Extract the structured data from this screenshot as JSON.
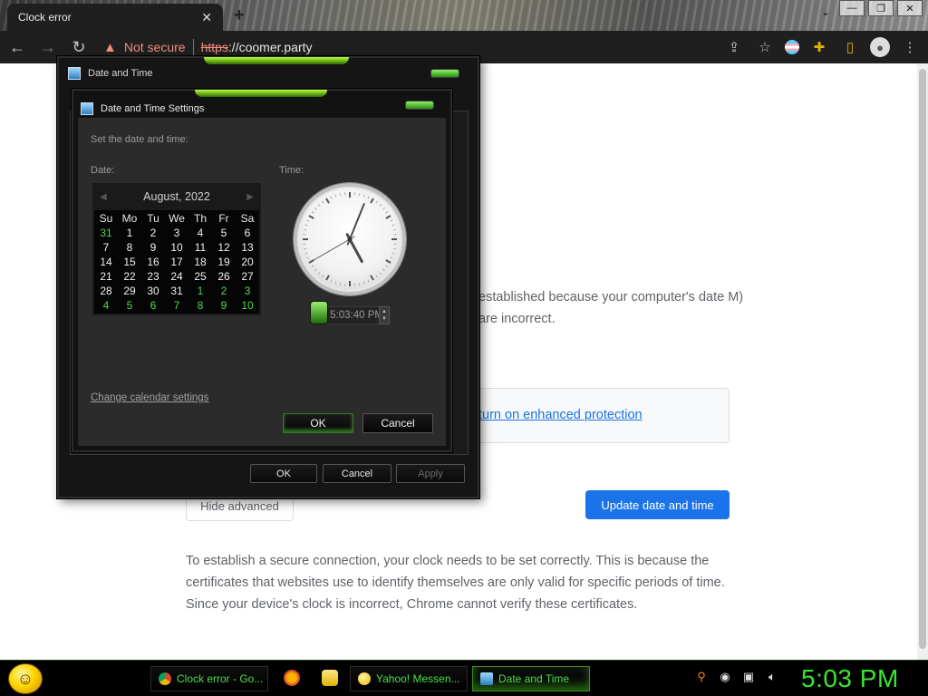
{
  "browser": {
    "tab_title": "Clock error",
    "tab_close": "✕",
    "new_tab": "+",
    "security_label": "Not secure",
    "url_scheme": "https",
    "url_rest": "://coomer.party",
    "window_controls": [
      "—",
      "❐",
      "✕"
    ]
  },
  "page": {
    "error_text": "established because your computer's date M) are incorrect.",
    "protection_link": "turn on enhanced protection",
    "hide_advanced": "Hide advanced",
    "update_button": "Update date and time",
    "explanation": "To establish a secure connection, your clock needs to be set correctly. This is because the certificates that websites use to identify themselves are only valid for specific periods of time. Since your device's clock is incorrect, Chrome cannot verify these certificates."
  },
  "outer_dialog": {
    "title": "Date and Time",
    "ok": "OK",
    "cancel": "Cancel",
    "apply": "Apply"
  },
  "inner_dialog": {
    "title": "Date and Time Settings",
    "instruction": "Set the date and time:",
    "date_label": "Date:",
    "time_label": "Time:",
    "month_year": "August, 2022",
    "weekdays": [
      "Su",
      "Mo",
      "Tu",
      "We",
      "Th",
      "Fr",
      "Sa"
    ],
    "days": [
      [
        "31",
        "1",
        "2",
        "3",
        "4",
        "5",
        "6"
      ],
      [
        "7",
        "8",
        "9",
        "10",
        "11",
        "12",
        "13"
      ],
      [
        "14",
        "15",
        "16",
        "17",
        "18",
        "19",
        "20"
      ],
      [
        "21",
        "22",
        "23",
        "24",
        "25",
        "26",
        "27"
      ],
      [
        "28",
        "29",
        "30",
        "31",
        "1",
        "2",
        "3"
      ],
      [
        "4",
        "5",
        "6",
        "7",
        "8",
        "9",
        "10"
      ]
    ],
    "other_month_days": [
      "0-0",
      "4-4",
      "4-5",
      "4-6",
      "5-0",
      "5-1",
      "5-2",
      "5-3",
      "5-4",
      "5-5",
      "5-6"
    ],
    "time_value": "5:03:40 PM",
    "clock": {
      "hour": 5,
      "minute": 3,
      "second": 40
    },
    "change_calendar": "Change calendar settings",
    "ok": "OK",
    "cancel": "Cancel"
  },
  "taskbar": {
    "items": [
      {
        "label": "Clock error - Go...",
        "icon": "chrome-icon"
      },
      {
        "label": "Yahoo! Messen...",
        "icon": "yahoo-messenger-icon"
      },
      {
        "label": "Date and Time",
        "icon": "date-time-icon"
      }
    ],
    "clock": "5:03 PM"
  },
  "colors": {
    "accent_green": "#39e62f",
    "chrome_blue": "#1a73e8",
    "warning_red": "#f28b82"
  }
}
